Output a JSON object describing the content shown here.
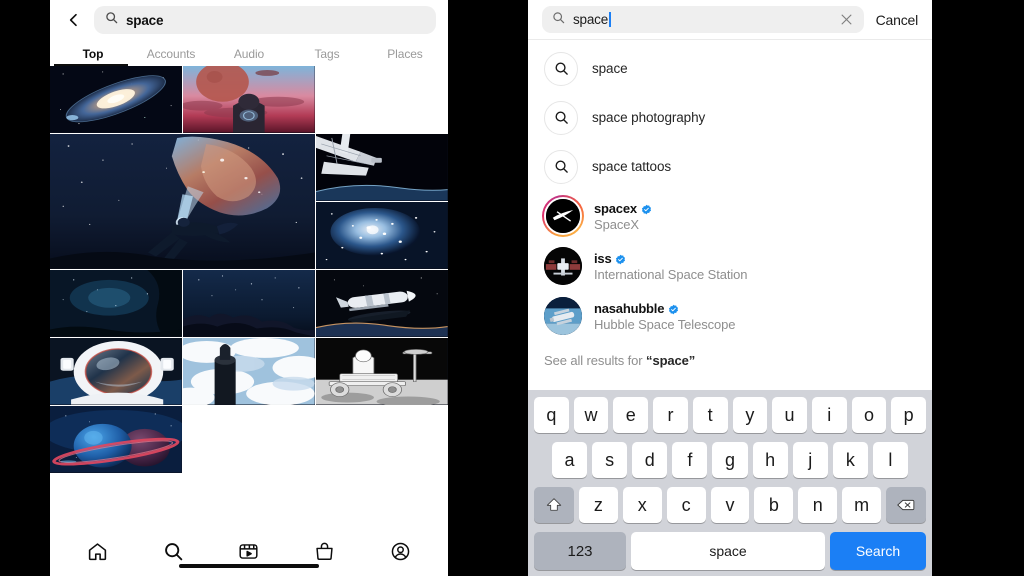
{
  "left_phone": {
    "back_icon": "back-chevron-icon",
    "search": {
      "icon": "search-icon",
      "value": "space",
      "placeholder": "Search"
    },
    "tabs": [
      {
        "label": "Top",
        "active": true
      },
      {
        "label": "Accounts",
        "active": false
      },
      {
        "label": "Audio",
        "active": false
      },
      {
        "label": "Tags",
        "active": false
      },
      {
        "label": "Places",
        "active": false
      }
    ],
    "grid": [
      {
        "name": "andromeda-galaxy",
        "span": "1x1"
      },
      {
        "name": "astronaut-red-planet-sunset",
        "span": "1x1"
      },
      {
        "name": "woman-nebula-levitating",
        "span": "2x2"
      },
      {
        "name": "shuttle-arm-earth-limb",
        "span": "1x1"
      },
      {
        "name": "blue-star-cluster",
        "span": "1x1"
      },
      {
        "name": "milky-way-over-trees",
        "span": "1x1"
      },
      {
        "name": "rocky-terrain-starfield",
        "span": "1x1"
      },
      {
        "name": "rocket-in-orbit",
        "span": "1x1"
      },
      {
        "name": "astronaut-helmet-visor-reflection",
        "span": "1x1"
      },
      {
        "name": "rocket-launch-clouds",
        "span": "1x1"
      },
      {
        "name": "lunar-rover-astronaut-bw",
        "span": "1x1"
      },
      {
        "name": "blue-ringed-planets",
        "span": "1x1"
      }
    ],
    "bottom_nav": [
      {
        "name": "home-icon",
        "label": "Home",
        "active": false
      },
      {
        "name": "search-icon",
        "label": "Search",
        "active": true
      },
      {
        "name": "reels-icon",
        "label": "Reels",
        "active": false
      },
      {
        "name": "shop-icon",
        "label": "Shop",
        "active": false
      },
      {
        "name": "profile-icon",
        "label": "Profile",
        "active": false
      }
    ]
  },
  "right_phone": {
    "search": {
      "icon": "search-icon",
      "value": "space",
      "placeholder": "Search",
      "clear_icon": "close-icon"
    },
    "cancel_label": "Cancel",
    "term_suggestions": [
      {
        "icon": "search-icon",
        "label": "space"
      },
      {
        "icon": "search-icon",
        "label": "space photography"
      },
      {
        "icon": "search-icon",
        "label": "space tattoos"
      }
    ],
    "account_suggestions": [
      {
        "username": "spacex",
        "full_name": "SpaceX",
        "verified": true,
        "has_story_ring": true,
        "avatar": "spacex-logo-avatar"
      },
      {
        "username": "iss",
        "full_name": "International Space Station",
        "verified": true,
        "has_story_ring": false,
        "avatar": "iss-station-avatar"
      },
      {
        "username": "nasahubble",
        "full_name": "Hubble Space Telescope",
        "verified": true,
        "has_story_ring": false,
        "avatar": "hubble-telescope-avatar"
      }
    ],
    "see_all": {
      "prefix": "See all results for ",
      "quoted_term": "“space”"
    },
    "keyboard": {
      "row1": [
        "q",
        "w",
        "e",
        "r",
        "t",
        "y",
        "u",
        "i",
        "o",
        "p"
      ],
      "row2": [
        "a",
        "s",
        "d",
        "f",
        "g",
        "h",
        "j",
        "k",
        "l"
      ],
      "row3": [
        "z",
        "x",
        "c",
        "v",
        "b",
        "n",
        "m"
      ],
      "shift_icon": "shift-icon",
      "backspace_icon": "backspace-icon",
      "numbers_label": "123",
      "space_label": "space",
      "search_label": "Search"
    }
  },
  "colors": {
    "accent_blue": "#1b7ff5",
    "verified_blue": "#1b90ee",
    "keyboard_bg": "#d1d3d9",
    "key_white": "#ffffff",
    "key_mod": "#aeb3bd",
    "pill_gray": "#efefef",
    "text_primary": "#262626",
    "text_secondary": "#8e8e8e"
  }
}
